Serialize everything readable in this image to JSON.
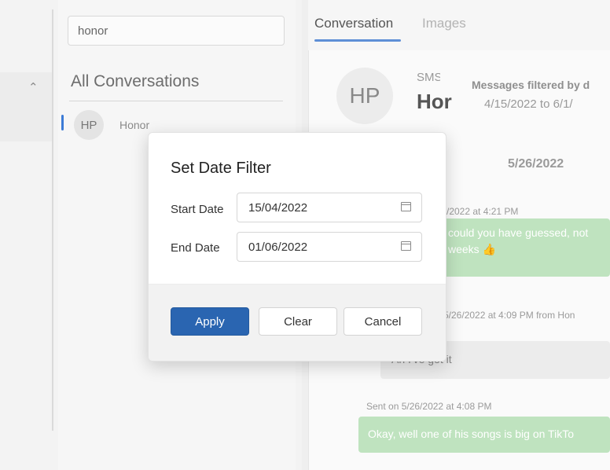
{
  "search": {
    "value": "honor"
  },
  "sidebar": {
    "caret_icon": "chevron-up-icon"
  },
  "list": {
    "title": "All Conversations",
    "items": [
      {
        "initials": "HP",
        "name": "Honor"
      }
    ]
  },
  "tabs": [
    {
      "label": "Conversation"
    },
    {
      "label": "Images"
    }
  ],
  "header": {
    "initials": "HP",
    "protocol": "SMS/il",
    "name": "Hor",
    "filter_text": "Messages filtered by d",
    "filter_range": "4/15/2022 to 6/1/"
  },
  "messages": {
    "date_header": "5/26/2022",
    "m1_meta": "/2022 at 4:21 PM",
    "m1_line1": "could you have guessed, not",
    "m1_line2": "weeks 👍",
    "m2_meta": "5/26/2022 at 4:09 PM from Hon",
    "m2_text": "Ah I've got it",
    "m3_meta": "Sent on 5/26/2022 at 4:08 PM",
    "m3_text": "Okay, well one of his songs is big on TikTo"
  },
  "dialog": {
    "title": "Set Date Filter",
    "start_label": "Start Date",
    "start_value": "15/04/2022",
    "end_label": "End Date",
    "end_value": "01/06/2022",
    "calendar_icon": "calendar-icon",
    "apply": "Apply",
    "clear": "Clear",
    "cancel": "Cancel"
  },
  "colors": {
    "accent": "#2a65b1",
    "tab_underline": "#5e8fd6",
    "sent_bubble": "#bfe3bf"
  }
}
